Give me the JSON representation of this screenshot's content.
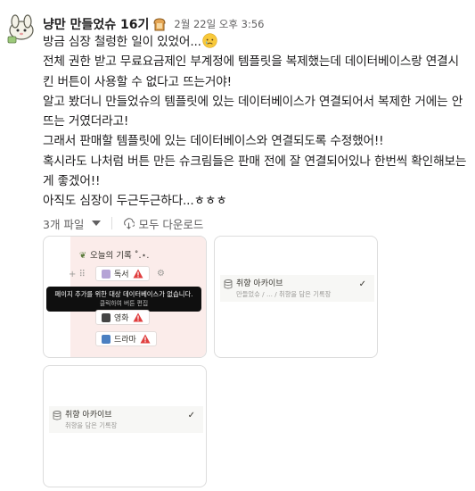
{
  "message": {
    "author": "냥만 만들었슈 16기",
    "timestamp": "2월 22일 오후 3:56",
    "lines": [
      "방금 심장 철렁한 일이 있었어...",
      "전체 권한 받고 무료요금제인 부계정에 템플릿을 복제했는데 데이터베이스랑 연결시킨 버튼이 사용할 수 없다고 뜨는거야!",
      "알고 봤더니 만들었슈의 템플릿에 있는 데이터베이스가 연결되어서 복제한 거에는 안뜨는 거였더라고!",
      "그래서 판매할 템플릿에 있는 데이터베이스와 연결되도록 수정했어!!",
      "혹시라도 나처럼 버튼 만든 슈크림들은 판매 전에 잘 연결되어있나 한번씩 확인해보는게 좋겠어!!",
      "아직도 심장이 두근두근하다...ㅎㅎㅎ"
    ],
    "icons": {
      "badge": "bread-icon",
      "emoji": "sad-tear-emoji",
      "avatar": "bunny-avatar-icon"
    }
  },
  "files": {
    "count_label": "3개 파일",
    "download_all_label": "모두 다운로드"
  },
  "attachments": {
    "card1": {
      "page_title": "오늘의 기록 ˚.⋆.",
      "rows": [
        "독서",
        "영화",
        "드라마"
      ],
      "tooltip_main": "페이지 추가를 위한 대상 데이터베이스가 없습니다.",
      "tooltip_sub": "클릭하여 버튼 편집"
    },
    "card2": {
      "title": "취향 아카이브",
      "subtitle": "만들었슈 / ... / 취향을 담은 기록장",
      "check": "✓"
    },
    "card3": {
      "title": "취향 아카이브",
      "subtitle": "취향을 담은 기록장",
      "check": "✓"
    }
  },
  "colors": {
    "text": "#1d1c1d",
    "muted": "#616061",
    "warning": "#e03e3e",
    "card_pink_bg": "#fbecea"
  }
}
